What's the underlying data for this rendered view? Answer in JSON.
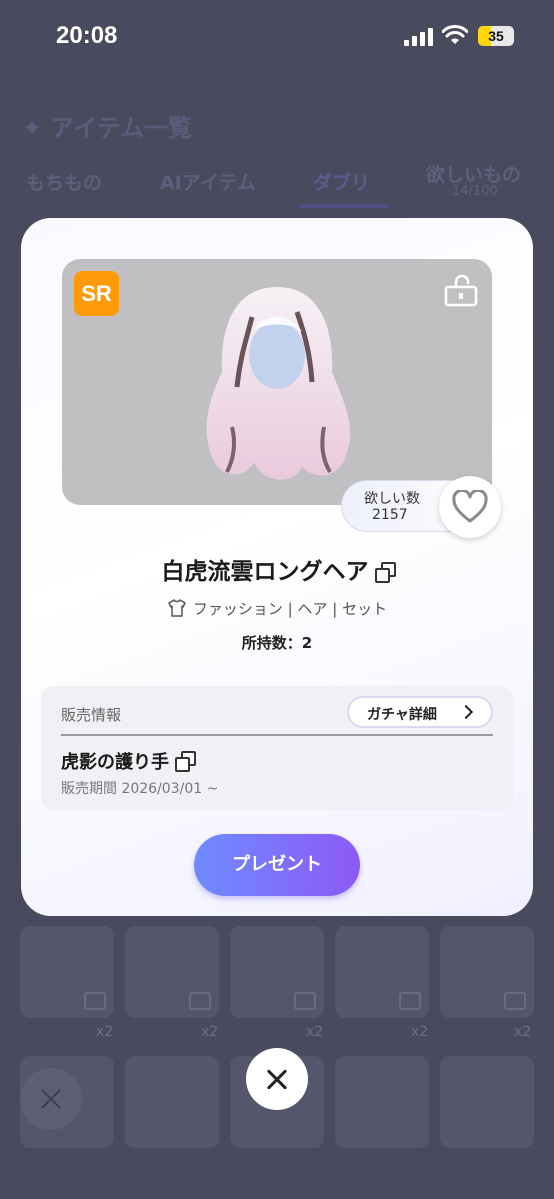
{
  "status_bar": {
    "time": "20:08",
    "battery": "35",
    "battery_level": 0.35
  },
  "background": {
    "title": "✦ アイテム一覧",
    "tabs": [
      {
        "label": "もちもの"
      },
      {
        "label": "AIアイテム"
      },
      {
        "label": "ダブリ"
      },
      {
        "label": "欲しいもの"
      }
    ],
    "wishlist_count": "14/100",
    "grid_counts": [
      "x2",
      "x2",
      "x2",
      "x2",
      "x2"
    ]
  },
  "modal": {
    "rarity": "SR",
    "want_label": "欲しい数",
    "want_count": "2157",
    "item_name": "白虎流雲ロングヘア",
    "categories": "ファッション | ヘア | セット",
    "owned": "所持数：2",
    "sales": {
      "label": "販売情報",
      "gacha_button": "ガチャ詳細",
      "gacha_name": "虎影の護り手",
      "period": "販売期間 2026/03/01 ~"
    },
    "present_button": "プレゼント"
  },
  "colors": {
    "accent_gradient_start": "#6e8bff",
    "accent_gradient_end": "#8d59f6",
    "rarity_badge": "#ff9a0a",
    "overlay": "#4a4a5e"
  },
  "icons": [
    "open-lock-icon",
    "heart-icon",
    "copy-icon",
    "shirt-icon",
    "chevron-right-icon",
    "close-icon"
  ]
}
